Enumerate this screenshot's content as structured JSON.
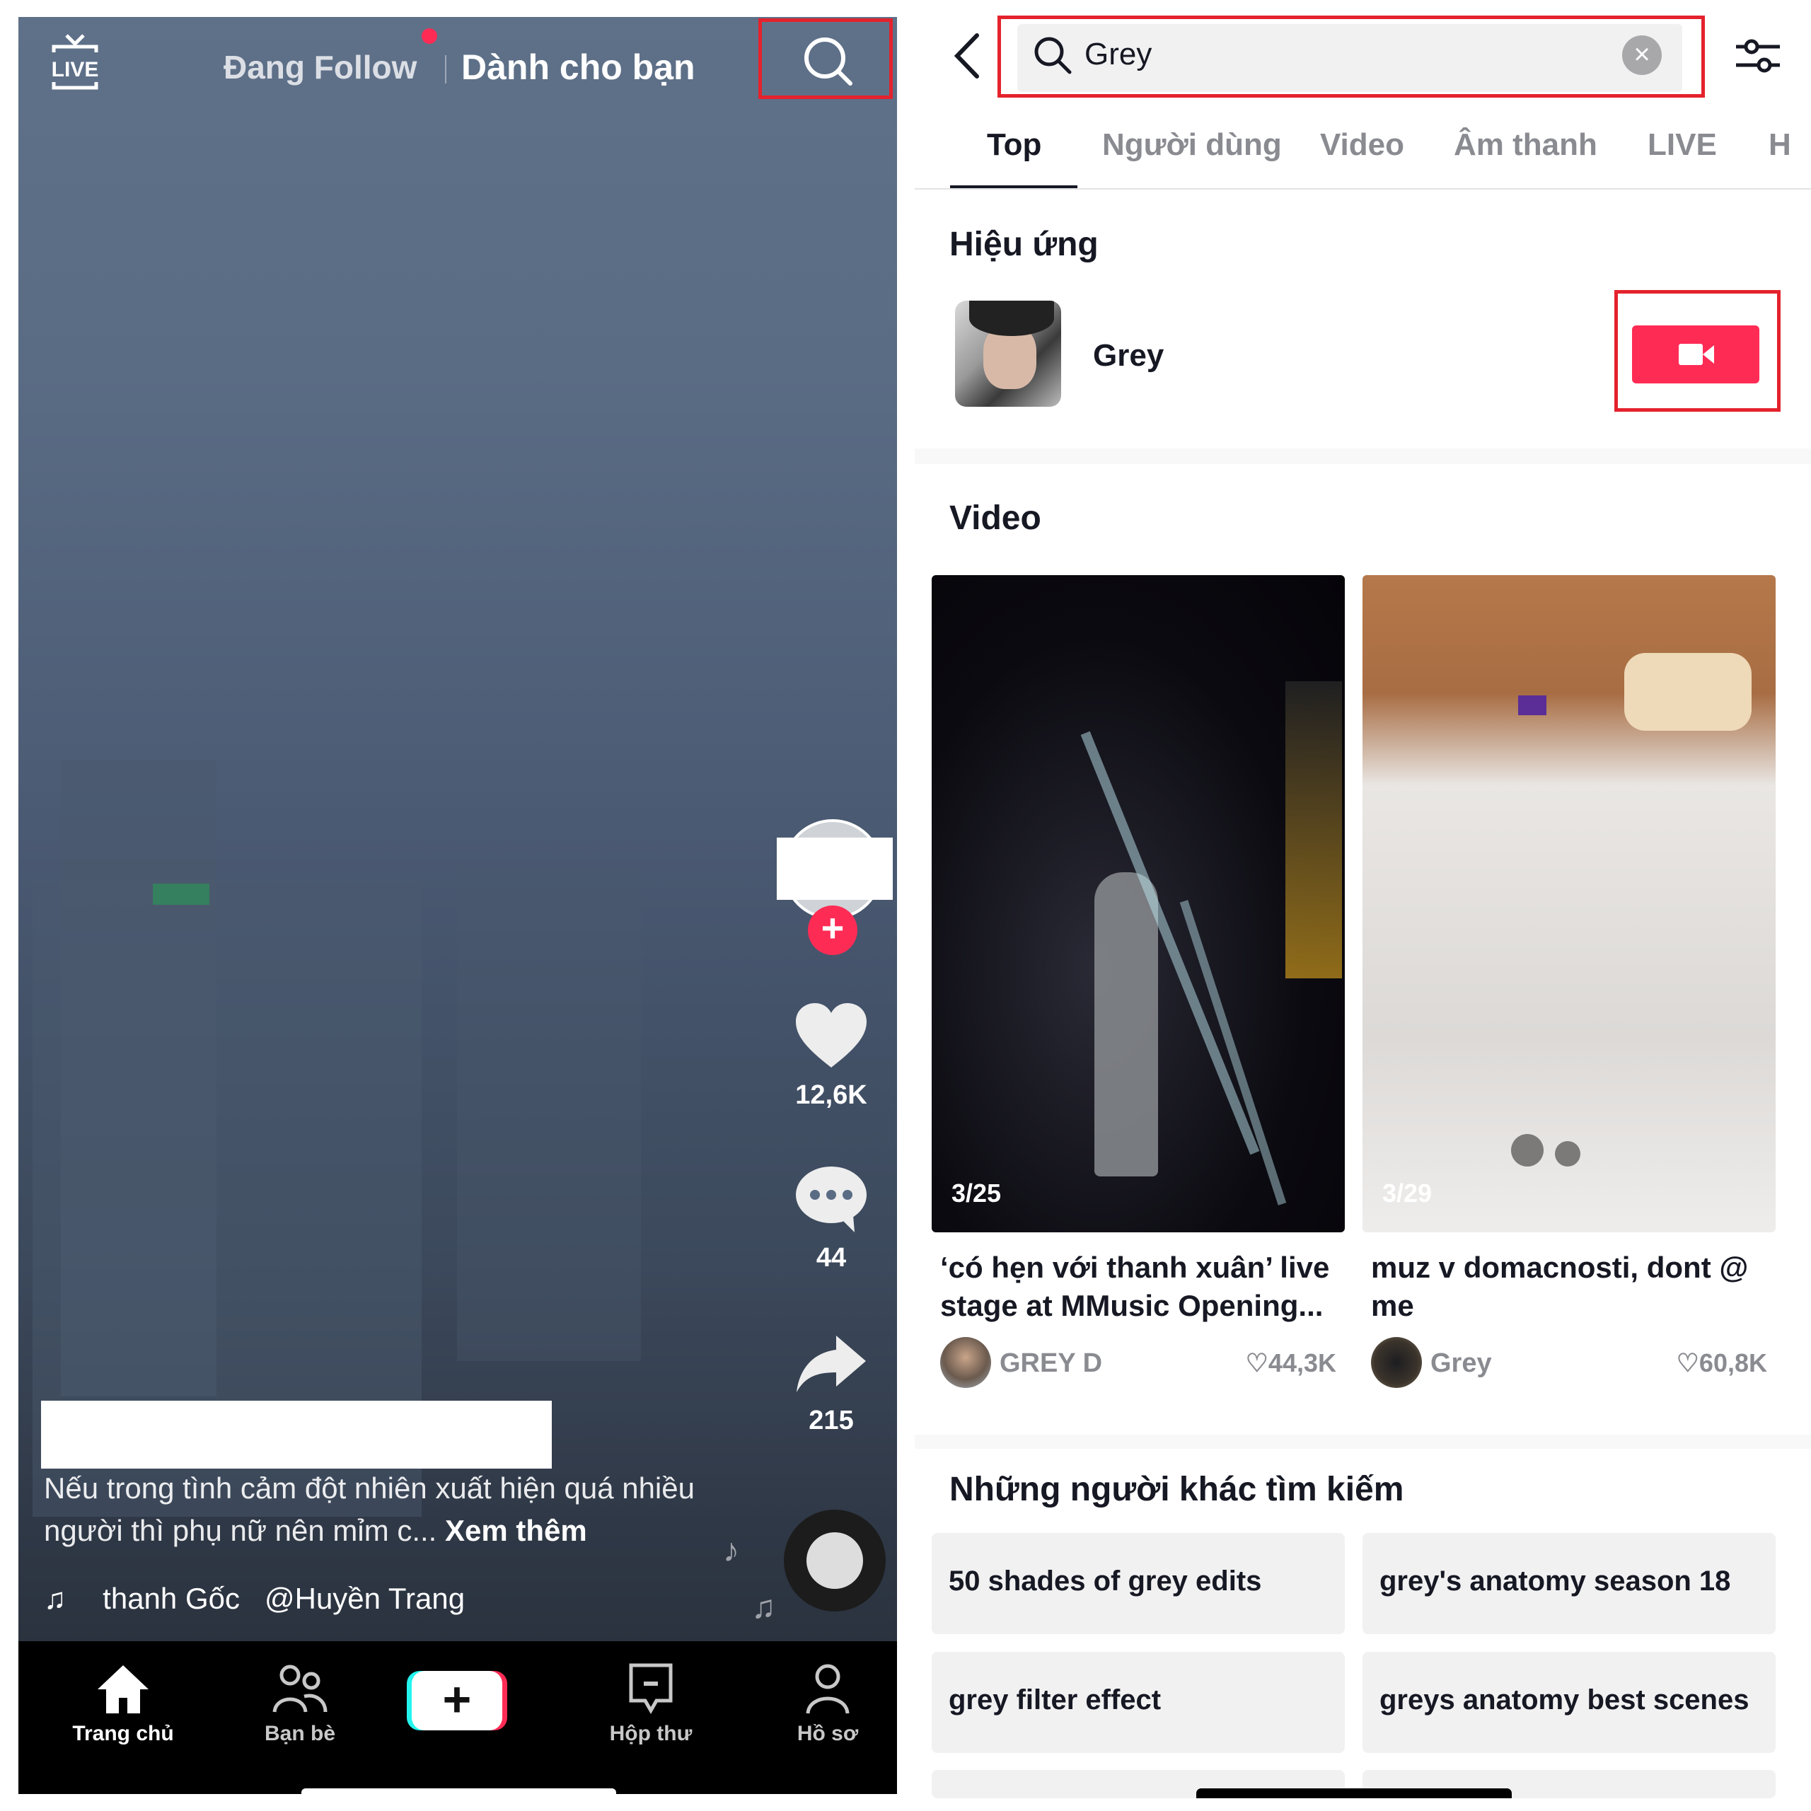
{
  "left_feed": {
    "header": {
      "live_icon": "live-tv-icon",
      "live_label": "LIVE",
      "tab_following": "Đang Follow",
      "tab_for_you": "Dành cho bạn",
      "search_icon": "search-icon"
    },
    "actions": {
      "likes": "12,6K",
      "comments": "44",
      "shares": "215",
      "follow_plus": "+"
    },
    "caption": {
      "text": "Nếu trong tình cảm đột nhiên xuất hiện quá nhiều người thì phụ nữ nên mỉm c...",
      "more": "Xem thêm"
    },
    "music": {
      "note": "♫",
      "text": "thanh Gốc   @Huyền Trang"
    },
    "bottom_nav": [
      {
        "label": "Trang chủ",
        "icon": "home-icon",
        "active": true
      },
      {
        "label": "Bạn bè",
        "icon": "friends-icon",
        "active": false
      },
      {
        "label": "+",
        "icon": "create-icon",
        "active": false
      },
      {
        "label": "Hộp thư",
        "icon": "inbox-icon",
        "active": false
      },
      {
        "label": "Hồ sơ",
        "icon": "profile-icon",
        "active": false
      }
    ]
  },
  "search_page": {
    "query": "Grey",
    "clear": "×",
    "tabs": [
      {
        "label": "Top",
        "active": true
      },
      {
        "label": "Người dùng",
        "active": false
      },
      {
        "label": "Video",
        "active": false
      },
      {
        "label": "Âm thanh",
        "active": false
      },
      {
        "label": "LIVE",
        "active": false
      },
      {
        "label": "H",
        "active": false
      }
    ],
    "effects": {
      "title": "Hiệu ứng",
      "items": [
        {
          "name": "Grey",
          "action_icon": "video-camera-icon"
        }
      ]
    },
    "videos": {
      "title": "Video",
      "items": [
        {
          "count": "3/25",
          "title": "‘có hẹn với thanh xuân’ live stage at MMusic Opening...",
          "author": "GREY D",
          "likes": "44,3K"
        },
        {
          "count": "3/29",
          "title": "muz v domacnosti, dont @ me",
          "author": "Grey",
          "likes": "60,8K"
        }
      ]
    },
    "others_search": {
      "title": "Những người khác tìm kiếm",
      "items": [
        "50 shades of grey edits",
        "grey's anatomy season 18",
        "grey filter effect",
        "greys anatomy best scenes",
        "",
        ""
      ]
    }
  },
  "colors": {
    "accent": "#fe2c55",
    "highlight_box": "#e4222d",
    "text_primary": "#161823",
    "text_secondary": "#8a8b91"
  }
}
